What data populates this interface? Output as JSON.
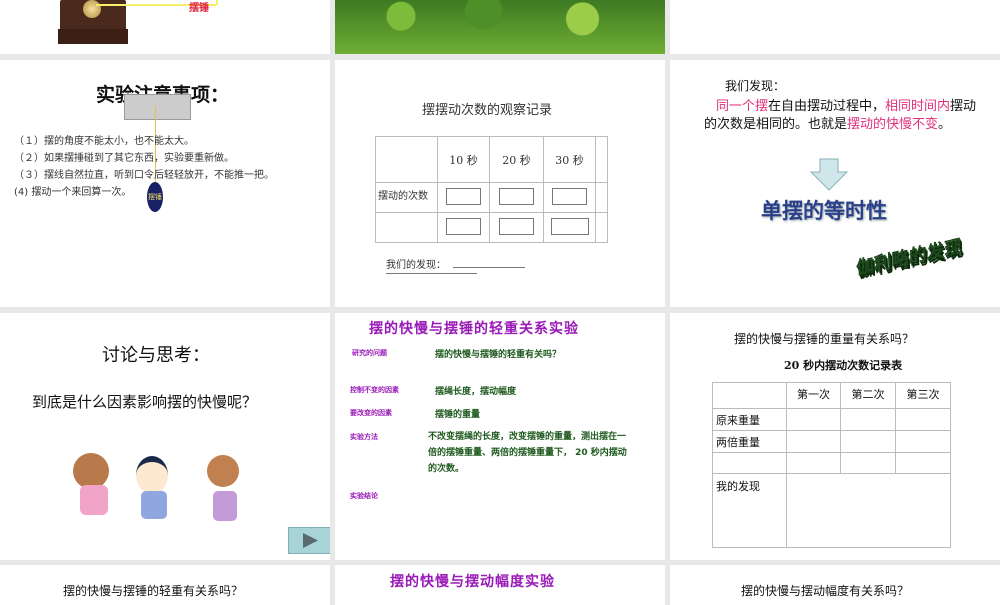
{
  "slide1": {
    "label": "摆锤"
  },
  "slide2": {},
  "slide3": {},
  "slide4": {
    "title": "实验注意事项：",
    "items": [
      "（１）摆的角度不能太小，也不能太大。",
      "（２）如果摆捶碰到了其它东西，实验要重新做。",
      "（３）摆线自然拉直，听到口令后轻轻放开，不能推一把。",
      "(4)   摆动一个来回算一次。"
    ],
    "bob_label": "摆锤"
  },
  "slide5": {
    "title": "摆摆动次数的观察记录",
    "headers": [
      "10 秒",
      "20 秒",
      "30 秒"
    ],
    "row_label": "摆动的次数",
    "finding_label": "我们的发现："
  },
  "slide6": {
    "intro": "我们发现：",
    "p1": "同一个摆",
    "p2": "在自由摆动过程中，",
    "p3": "相同时间内",
    "p4": "摆动的次数是相同的。也就是",
    "p5": "摆动的快慢不变",
    "p6": "。",
    "heading": "单摆的等时性",
    "wordart": "伽利略的发现"
  },
  "slide7": {
    "title": "讨论与思考：",
    "question": "到底是什么因素影响摆的快慢呢？",
    "play_icon": "play-icon"
  },
  "slide8": {
    "title": "摆的快慢与摆锤的轻重关系实验",
    "rows": [
      {
        "label": "研究的问题",
        "value": "摆的快慢与摆锤的轻重有关吗？"
      },
      {
        "label": "控制不变的因素",
        "value": "摆绳长度，摆动幅度"
      },
      {
        "label": "要改变的因素",
        "value": "摆锤的重量"
      },
      {
        "label": "实验方法",
        "value": "不改变摆绳的长度，改变摆锤的重量，测出摆在一倍的摆锤重量、两倍的摆锤重量下， 20 秒内摆动的次数。"
      },
      {
        "label": "实验结论",
        "value": ""
      }
    ]
  },
  "slide9": {
    "title": "摆的快慢与摆锤的重量有关系吗？",
    "subtitle": "20 秒内摆动次数记录表",
    "headers": [
      "第一次",
      "第二次",
      "第三次"
    ],
    "rows": [
      "原来重量",
      "两倍重量",
      ""
    ],
    "finding": "我的发现"
  },
  "slide10": {
    "title": "摆的快慢与摆锤的轻重有关系吗？"
  },
  "slide11": {
    "title": "摆的快慢与摆动幅度实验"
  },
  "slide12": {
    "title": "摆的快慢与摆动幅度有关系吗？"
  }
}
